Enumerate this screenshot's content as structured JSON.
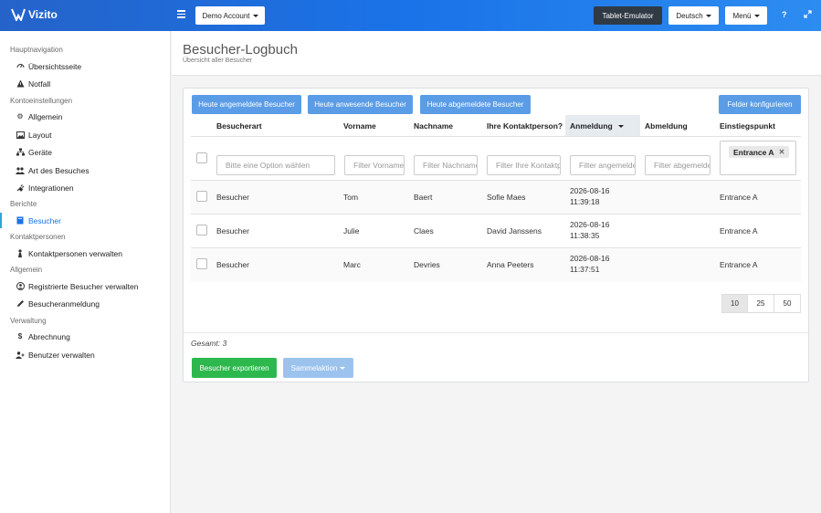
{
  "app": {
    "logo_text": "Vizito",
    "brand_color": "#1a73e8"
  },
  "topbar": {
    "account_label": "Demo Account",
    "tablet_label": "Tablet-Emulator",
    "language_label": "Deutsch",
    "menu_label": "Menü",
    "help_icon": "question-icon",
    "expand_icon": "expand-icon"
  },
  "sidebar": {
    "sections": [
      {
        "label": "Hauptnavigation",
        "items": [
          {
            "label": "Übersichtsseite",
            "icon": "dashboard-icon"
          },
          {
            "label": "Notfall",
            "icon": "warning-icon"
          }
        ]
      },
      {
        "label": "Kontoeinstellungen",
        "items": [
          {
            "label": "Allgemein",
            "icon": "gear-icon"
          },
          {
            "label": "Layout",
            "icon": "image-icon"
          },
          {
            "label": "Geräte",
            "icon": "sitemap-icon"
          },
          {
            "label": "Art des Besuches",
            "icon": "users-icon"
          },
          {
            "label": "Integrationen",
            "icon": "plug-icon"
          }
        ]
      },
      {
        "label": "Berichte",
        "items": [
          {
            "label": "Besucher",
            "icon": "book-icon",
            "active": true
          }
        ]
      },
      {
        "label": "Kontaktpersonen",
        "items": [
          {
            "label": "Kontaktpersonen verwalten",
            "icon": "person-icon"
          }
        ]
      },
      {
        "label": "Allgemein",
        "items": [
          {
            "label": "Registrierte Besucher verwalten",
            "icon": "user-circle-icon"
          },
          {
            "label": "Besucheranmeldung",
            "icon": "pencil-icon"
          }
        ]
      },
      {
        "label": "Verwaltung",
        "items": [
          {
            "label": "Abrechnung",
            "icon": "dollar-icon"
          },
          {
            "label": "Benutzer verwalten",
            "icon": "user-plus-icon"
          }
        ]
      }
    ]
  },
  "header": {
    "title": "Besucher-Logbuch",
    "subtitle": "Übersicht aller Besucher"
  },
  "toolbar": {
    "btn_today_registered": "Heute angemeldete Besucher",
    "btn_today_present": "Heute anwesende Besucher",
    "btn_today_signed_out": "Heute abgemeldete Besucher",
    "btn_configure": "Felder konfigurieren"
  },
  "table": {
    "columns": [
      "Besucherart",
      "Vorname",
      "Nachname",
      "Ihre Kontaktperson?",
      "Anmeldung",
      "Abmeldung",
      "Einstiegspunkt"
    ],
    "filters": {
      "type_placeholder": "Bitte eine Option wählen",
      "first_name_placeholder": "Filter Vorname",
      "last_name_placeholder": "Filter Nachname",
      "contact_placeholder": "Filter Ihre Kontaktperson",
      "login_placeholder": "Filter angemeldet",
      "logout_placeholder": "Filter abgemeldet",
      "entry_tag": "Entrance A"
    },
    "rows": [
      {
        "type": "Besucher",
        "first": "Tom",
        "last": "Baert",
        "contact": "Sofie Maes",
        "login_date": "2026-08-16",
        "login_time": "11:39:18",
        "logout": "",
        "entry": "Entrance A"
      },
      {
        "type": "Besucher",
        "first": "Julie",
        "last": "Claes",
        "contact": "David Janssens",
        "login_date": "2026-08-16",
        "login_time": "11:38:35",
        "logout": "",
        "entry": "Entrance A"
      },
      {
        "type": "Besucher",
        "first": "Marc",
        "last": "Devries",
        "contact": "Anna Peeters",
        "login_date": "2026-08-16",
        "login_time": "11:37:51",
        "logout": "",
        "entry": "Entrance A"
      }
    ],
    "page_sizes": [
      "10",
      "25",
      "50"
    ],
    "total_label": "Gesamt: 3"
  },
  "footer": {
    "export_label": "Besucher exportieren",
    "bulk_label": "Sammelaktion"
  }
}
